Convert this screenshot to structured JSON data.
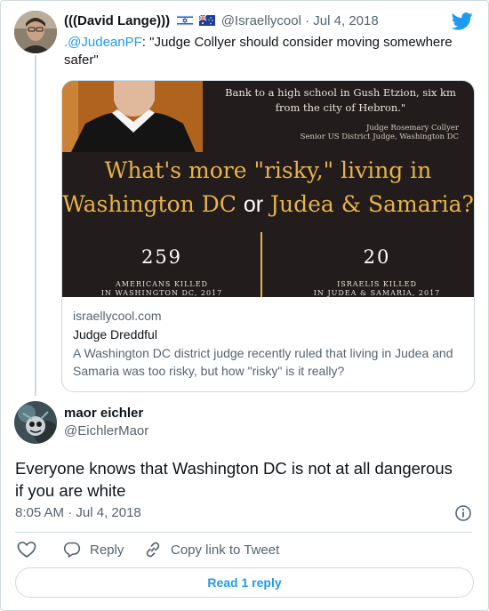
{
  "quoted_tweet": {
    "author_name": "(((David Lange)))",
    "handle": "@Israellycool",
    "separator": "·",
    "date": "Jul 4, 2018",
    "reply_mention": ".@JudeanPF",
    "text": ": \"Judge Collyer should consider moving somewhere safer\""
  },
  "card": {
    "image_caption_line1": "Bank to a high school in Gush Etzion, six km",
    "image_caption_line2": "from the city of Hebron.\"",
    "judge_name": "Judge Rosemary Collyer",
    "judge_title": "Senior US District Judge, Washington DC",
    "headline_line1": "What's more \"risky,\" living in",
    "headline_dc": "Washington DC",
    "headline_or": "or",
    "headline_js": "Judea & Samaria?",
    "stat_left_value": "259",
    "stat_left_label_line1": "AMERICANS KILLED",
    "stat_left_label_line2": "IN WASHINGTON DC, 2017",
    "stat_right_value": "20",
    "stat_right_label_line1": "ISRAELIS KILLED",
    "stat_right_label_line2": "IN JUDEA & SAMARIA, 2017",
    "domain": "israellycool.com",
    "title": "Judge Dreddful",
    "description": "A Washington DC district judge recently ruled that living in Judea and Samaria was too risky, but how \"risky\" is it really?"
  },
  "main_tweet": {
    "author_name": "maor eichler",
    "handle": "@EichlerMaor",
    "text": "Everyone knows that Washington DC is not at all dangerous if you are white",
    "time": "8:05 AM",
    "separator": "·",
    "date": "Jul 4, 2018"
  },
  "actions": {
    "reply_label": "Reply",
    "copy_label": "Copy link to Tweet",
    "read_replies_label": "Read 1 reply"
  },
  "colors": {
    "accent": "#1d9bf0",
    "card_bg": "#221d1c",
    "headline": "#e8b24a"
  },
  "icons": [
    "twitter-bird-icon",
    "flag-israel-icon",
    "flag-australia-icon",
    "info-icon",
    "heart-icon",
    "reply-icon",
    "link-icon"
  ]
}
